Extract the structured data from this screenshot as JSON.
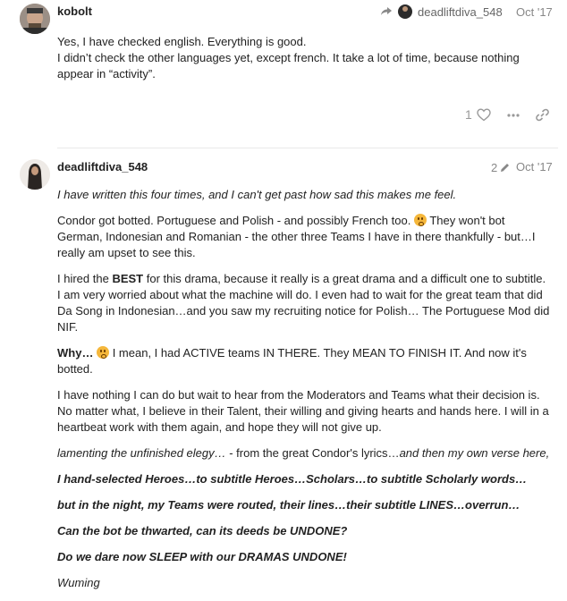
{
  "post1": {
    "username": "kobolt",
    "reply_to": "deadliftdiva_548",
    "date": "Oct '17",
    "lines": [
      "Yes, I have checked english. Everything is good.",
      "I didn’t check the other languages yet, except french. It take a lot of time, because nothing appear in “activity”."
    ],
    "like_count": "1"
  },
  "post2": {
    "username": "deadliftdiva_548",
    "edit_count": "2",
    "date": "Oct '17",
    "p1": "I have written this four times, and I can't get past how sad this makes me feel.",
    "p2a": "Condor got botted. Portuguese and Polish - and possibly French too.",
    "p2b": "They won't bot German, Indonesian and Romanian - the other three Teams I have in there thankfully - but…I really am upset to see this.",
    "p3a": "I hired the ",
    "p3b": "BEST",
    "p3c": " for this drama, because it really is a great drama and a difficult one to subtitle. I am very worried about what the machine will do. I even had to wait for the great team that did Da Song in Indonesian…and you saw my recruiting notice for Polish… The Portuguese Mod did NIF.",
    "p4a": "Why…",
    "p4b": "I mean, I had ACTIVE teams IN THERE. They MEAN TO FINISH IT. And now it's botted.",
    "p5": "I have nothing I can do but wait to hear from the Moderators and Teams what their decision is. No matter what, I believe in their Talent, their willing and giving hearts and hands here. I will in a heartbeat work with them again, and hope they will not give up.",
    "p6a": "lamenting the unfinished elegy…",
    "p6b": " - from the great Condor's lyrics…",
    "p6c": "and then my own verse here,",
    "v1": "I hand-selected Heroes…to subtitle Heroes…Scholars…to subtitle Scholarly words…",
    "v2": "but in the night, my Teams were routed, their lines…their subtitle LINES…overrun…",
    "v3": "Can the bot be thwarted, can its deeds be UNDONE?",
    "v4": "Do we dare now SLEEP with our DRAMAS UNDONE!",
    "sig": "Wuming"
  },
  "icons": [
    "avatar-kobolt",
    "reply-arrow-icon",
    "avatar-deadliftdiva",
    "heart-icon",
    "more-icon",
    "link-icon",
    "pencil-icon",
    "frowning-emoji"
  ]
}
